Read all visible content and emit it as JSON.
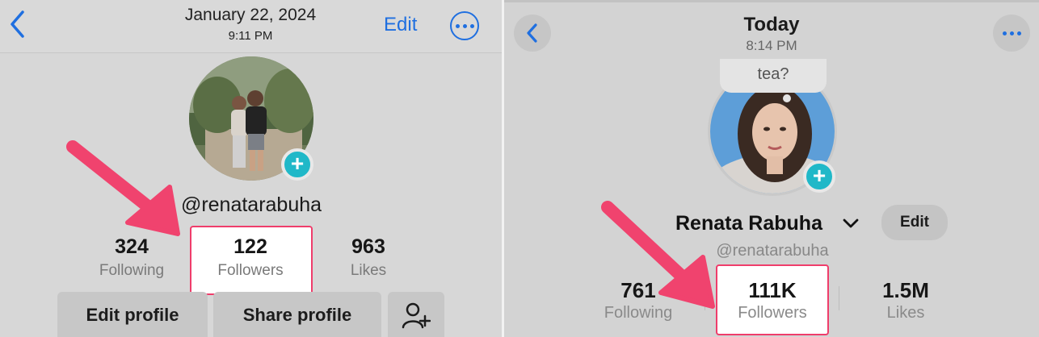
{
  "left": {
    "header": {
      "date": "January 22, 2024",
      "time": "9:11 PM",
      "edit_label": "Edit"
    },
    "username": "@renatarabuha",
    "stats": [
      {
        "value": "324",
        "label": "Following"
      },
      {
        "value": "122",
        "label": "Followers"
      },
      {
        "value": "963",
        "label": "Likes"
      }
    ],
    "buttons": {
      "edit_profile": "Edit profile",
      "share_profile": "Share profile"
    }
  },
  "right": {
    "header": {
      "title": "Today",
      "time": "8:14 PM"
    },
    "bubble_text": "tea?",
    "display_name": "Renata Rabuha",
    "edit_label": "Edit",
    "username": "@renatarabuha",
    "stats": [
      {
        "value": "761",
        "label": "Following"
      },
      {
        "value": "111K",
        "label": "Followers"
      },
      {
        "value": "1.5M",
        "label": "Likes"
      }
    ]
  },
  "colors": {
    "ios_blue": "#1f6fe0",
    "highlight_border": "#ef3d6b",
    "arrow": "#f0436e",
    "plus_badge": "#20b8c8"
  },
  "icons": [
    "back-chevron-icon",
    "more-options-icon",
    "add-story-plus-icon",
    "add-friend-icon",
    "dropdown-chevron-icon",
    "annotation-arrow-icon"
  ]
}
